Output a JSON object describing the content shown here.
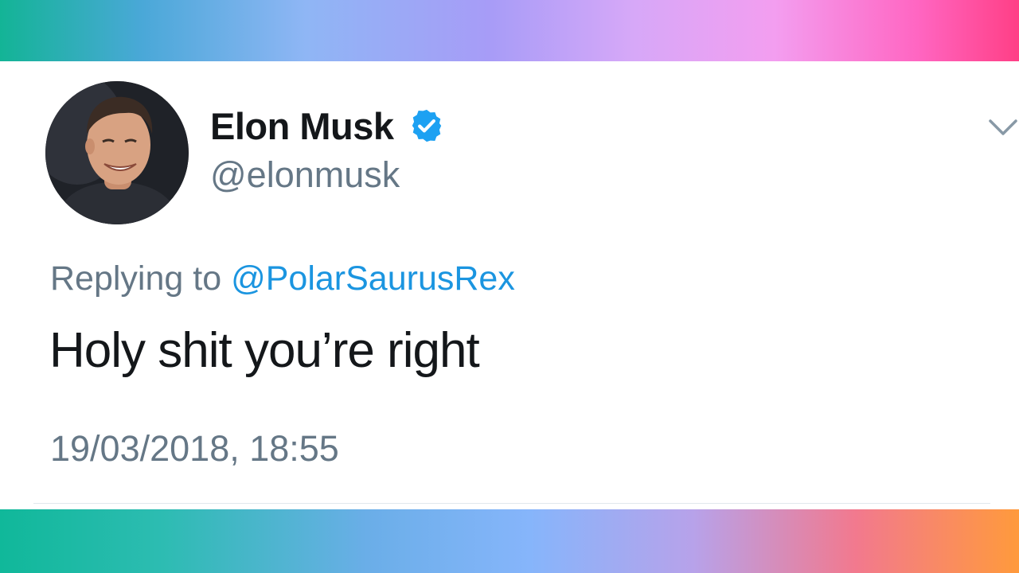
{
  "tweet": {
    "author": {
      "name": "Elon Musk",
      "handle": "@elonmusk",
      "verified": true
    },
    "replying_to_label": "Replying to",
    "replying_to_handle": "@PolarSaurusRex",
    "text": "Holy shit you’re right",
    "timestamp": "19/03/2018, 18:55"
  },
  "icons": {
    "verified": "verified-badge-icon",
    "menu": "chevron-down-icon"
  },
  "colors": {
    "text_primary": "#14171a",
    "text_secondary": "#657786",
    "link": "#1b95e0",
    "verified": "#1da1f2"
  }
}
